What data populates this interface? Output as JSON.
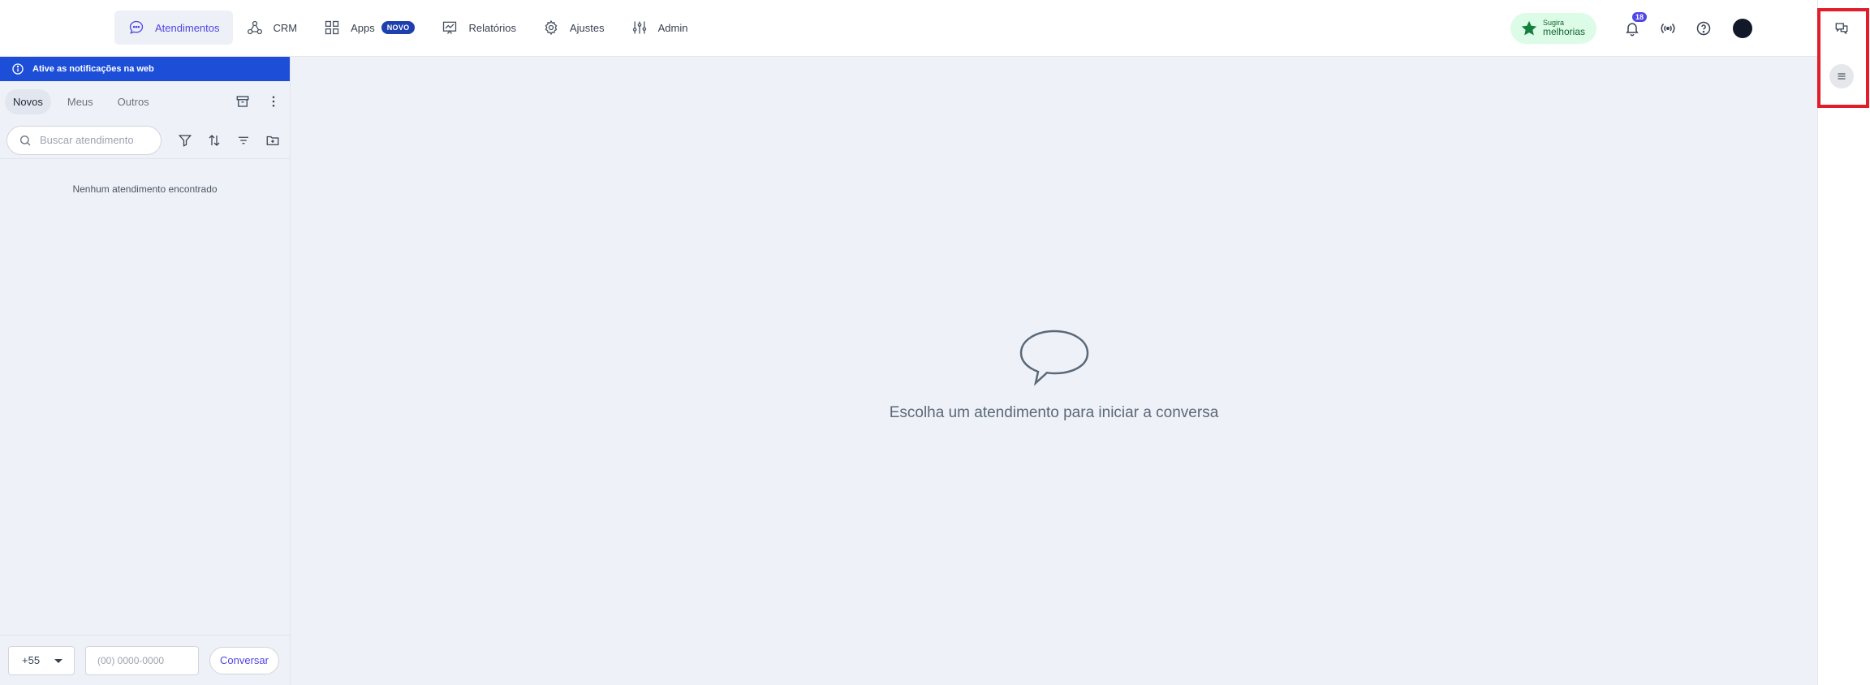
{
  "nav": {
    "items": [
      {
        "label": "Atendimentos",
        "icon": "chat-bubble-icon",
        "active": true
      },
      {
        "label": "CRM",
        "icon": "crm-nodes-icon"
      },
      {
        "label": "Apps",
        "icon": "apps-grid-icon",
        "badge": "NOVO"
      },
      {
        "label": "Relatórios",
        "icon": "reports-chart-icon"
      },
      {
        "label": "Ajustes",
        "icon": "gear-icon"
      },
      {
        "label": "Admin",
        "icon": "sliders-icon"
      }
    ]
  },
  "header": {
    "suggest_line1": "Sugira",
    "suggest_line2": "melhorias",
    "notification_count": "18"
  },
  "sidebar": {
    "notice": "Ative as notificações na web",
    "tabs": [
      "Novos",
      "Meus",
      "Outros"
    ],
    "search_placeholder": "Buscar atendimento",
    "empty_message": "Nenhum atendimento encontrado",
    "country_code": "+55",
    "phone_placeholder": "(00) 0000-0000",
    "start_button": "Conversar"
  },
  "main": {
    "empty_message": "Escolha um atendimento para iniciar a conversa"
  },
  "colors": {
    "accent": "#4f46e5",
    "notice_bg": "#1d4ed8",
    "suggest_bg": "#dcfce7",
    "highlight": "#e11d2a"
  }
}
